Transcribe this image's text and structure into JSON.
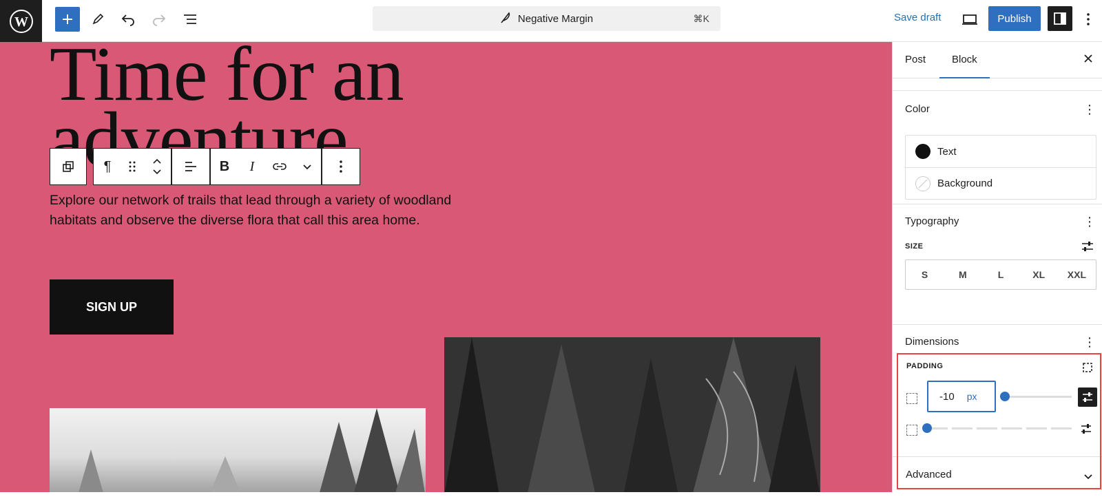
{
  "topbar": {
    "document_title": "Negative Margin",
    "shortcut": "⌘K",
    "save_draft_label": "Save draft",
    "publish_label": "Publish",
    "accent_color": "#2f6fbf"
  },
  "canvas": {
    "background_color": "#d95876",
    "heading": "Time for an adventure",
    "paragraph": "Explore our network of trails that lead through a variety of woodland habitats and observe the diverse flora that call this area home.",
    "button_label": "SIGN UP",
    "block_toolbar": {
      "icons": [
        "duplicate-icon",
        "paragraph-icon",
        "drag-handle-icon",
        "move-up-down-icon",
        "align-icon",
        "bold-icon",
        "italic-icon",
        "link-icon",
        "more-options-chevron-icon",
        "kebab-menu-icon"
      ],
      "bold_glyph": "B",
      "italic_glyph": "I",
      "pilcrow_glyph": "¶"
    }
  },
  "sidebar": {
    "tabs": [
      {
        "label": "Post"
      },
      {
        "label": "Block",
        "active": true
      }
    ],
    "color": {
      "title": "Color",
      "items": [
        {
          "label": "Text",
          "swatch": "#111111"
        },
        {
          "label": "Background",
          "swatch": "none"
        }
      ]
    },
    "typography": {
      "title": "Typography",
      "size_label": "SIZE",
      "sizes": [
        "S",
        "M",
        "L",
        "XL",
        "XXL"
      ]
    },
    "dimensions": {
      "title": "Dimensions",
      "padding_label": "PADDING",
      "padding_value": "-10",
      "padding_unit": "px"
    },
    "advanced": {
      "title": "Advanced"
    }
  }
}
